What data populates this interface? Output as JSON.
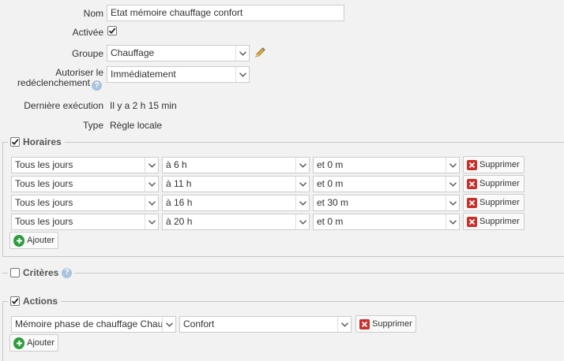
{
  "form": {
    "name_label": "Nom",
    "name_value": "Etat mémoire chauffage confort",
    "active_label": "Activée",
    "group_label": "Groupe",
    "group_value": "Chauffage",
    "retrigger_label_line1": "Autoriser le",
    "retrigger_label_line2": "redéclenchement",
    "retrigger_value": "Immédiatement",
    "last_exec_label": "Dernière exécution",
    "last_exec_value": "Il y a 2 h 15 min",
    "type_label": "Type",
    "type_value": "Règle locale"
  },
  "schedules": {
    "legend": "Horaires",
    "rows": [
      {
        "day": "Tous les jours",
        "hour": "à 6 h",
        "minute": "et 0 m",
        "delete": "Supprimer"
      },
      {
        "day": "Tous les jours",
        "hour": "à 11 h",
        "minute": "et 0 m",
        "delete": "Supprimer"
      },
      {
        "day": "Tous les jours",
        "hour": "à 16 h",
        "minute": "et 30 m",
        "delete": "Supprimer"
      },
      {
        "day": "Tous les jours",
        "hour": "à 20 h",
        "minute": "et 0 m",
        "delete": "Supprimer"
      }
    ],
    "add": "Ajouter"
  },
  "criteria": {
    "legend": "Critères"
  },
  "actions": {
    "legend": "Actions",
    "rows": [
      {
        "target": "Mémoire phase de chauffage Chauf",
        "value": "Confort",
        "delete": "Supprimer"
      }
    ],
    "add": "Ajouter"
  },
  "icons": {
    "checkbox_checked": "checkmark-icon",
    "dropdown": "chevron-down-icon",
    "edit": "pencil-icon",
    "help": "help-icon",
    "delete": "close-icon",
    "add": "plus-icon"
  },
  "colors": {
    "delete_icon": "#c9302c",
    "add_icon": "#2e9d3f",
    "help_icon": "#a9c4dc"
  }
}
